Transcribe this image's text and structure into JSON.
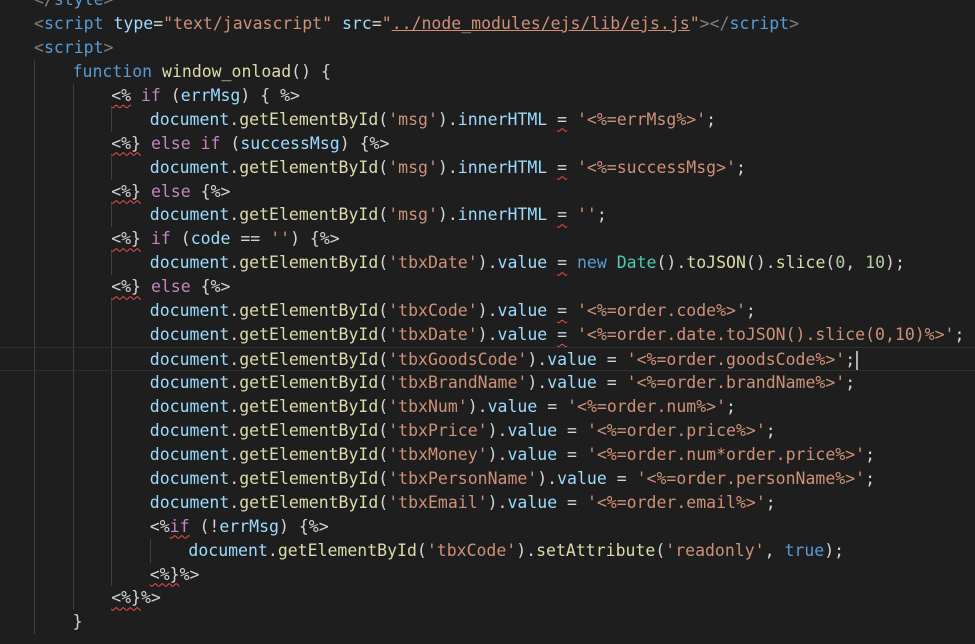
{
  "editor": {
    "language": "html",
    "theme_colors": {
      "background": "#1e1e1e",
      "tag": "#569cd6",
      "attribute": "#9cdcfe",
      "string": "#ce9178",
      "keyword": "#569cd6",
      "control": "#c586c0",
      "function": "#dcdcaa",
      "variable": "#9cdcfe",
      "class": "#4ec9b0",
      "number": "#b5cea8",
      "error_squiggle": "#f14c4c"
    },
    "lines": [
      {
        "indent": 0,
        "tokens": [
          [
            "</",
            "punct"
          ],
          [
            "style",
            "tag"
          ],
          [
            ">",
            "punct"
          ]
        ]
      },
      {
        "indent": 0,
        "tokens": [
          [
            "<",
            "punct"
          ],
          [
            "script",
            "tag"
          ],
          [
            " ",
            "plain"
          ],
          [
            "type",
            "attr"
          ],
          [
            "=",
            "plain"
          ],
          [
            "\"text/javascript\"",
            "str"
          ],
          [
            " ",
            "plain"
          ],
          [
            "src",
            "attr"
          ],
          [
            "=",
            "plain"
          ],
          [
            "\"",
            "str"
          ],
          [
            "../node_modules/ejs/lib/ejs.js",
            "str link"
          ],
          [
            "\"",
            "str"
          ],
          [
            "></",
            "punct"
          ],
          [
            "script",
            "tag"
          ],
          [
            ">",
            "punct"
          ]
        ]
      },
      {
        "indent": 0,
        "tokens": [
          [
            "<",
            "punct"
          ],
          [
            "script",
            "tag"
          ],
          [
            ">",
            "punct"
          ]
        ]
      },
      {
        "indent": 1,
        "tokens": [
          [
            "function",
            "kw"
          ],
          [
            " ",
            "plain"
          ],
          [
            "window_onload",
            "fn"
          ],
          [
            "() {",
            "plain"
          ]
        ]
      },
      {
        "indent": 2,
        "tokens": [
          [
            "<%",
            "plain squig"
          ],
          [
            " ",
            "plain"
          ],
          [
            "if",
            "ctrl"
          ],
          [
            " (",
            "plain"
          ],
          [
            "errMsg",
            "var"
          ],
          [
            ") { ",
            "plain"
          ],
          [
            "%>",
            "plain"
          ]
        ]
      },
      {
        "indent": 3,
        "tokens": [
          [
            "document",
            "var"
          ],
          [
            ".",
            "plain"
          ],
          [
            "getElementById",
            "fn"
          ],
          [
            "(",
            "plain"
          ],
          [
            "'msg'",
            "str"
          ],
          [
            ").",
            "plain"
          ],
          [
            "innerHTML",
            "var"
          ],
          [
            " ",
            "plain"
          ],
          [
            "=",
            "plain squig"
          ],
          [
            " ",
            "plain"
          ],
          [
            "'<%=errMsg%>'",
            "str"
          ],
          [
            ";",
            "plain"
          ]
        ]
      },
      {
        "indent": 2,
        "tokens": [
          [
            "<%}",
            "plain squig"
          ],
          [
            " ",
            "plain"
          ],
          [
            "else",
            "ctrl"
          ],
          [
            " ",
            "plain"
          ],
          [
            "if",
            "ctrl"
          ],
          [
            " (",
            "plain"
          ],
          [
            "successMsg",
            "var"
          ],
          [
            ") {",
            "plain"
          ],
          [
            "%>",
            "plain"
          ]
        ]
      },
      {
        "indent": 3,
        "tokens": [
          [
            "document",
            "var"
          ],
          [
            ".",
            "plain"
          ],
          [
            "getElementById",
            "fn"
          ],
          [
            "(",
            "plain"
          ],
          [
            "'msg'",
            "str"
          ],
          [
            ").",
            "plain"
          ],
          [
            "innerHTML",
            "var"
          ],
          [
            " ",
            "plain"
          ],
          [
            "=",
            "plain squig"
          ],
          [
            " ",
            "plain"
          ],
          [
            "'<%=successMsg>'",
            "str"
          ],
          [
            ";",
            "plain"
          ]
        ]
      },
      {
        "indent": 2,
        "tokens": [
          [
            "<%}",
            "plain squig"
          ],
          [
            " ",
            "plain"
          ],
          [
            "else",
            "ctrl"
          ],
          [
            " {",
            "plain"
          ],
          [
            "%>",
            "plain"
          ]
        ]
      },
      {
        "indent": 3,
        "tokens": [
          [
            "document",
            "var"
          ],
          [
            ".",
            "plain"
          ],
          [
            "getElementById",
            "fn"
          ],
          [
            "(",
            "plain"
          ],
          [
            "'msg'",
            "str"
          ],
          [
            ").",
            "plain"
          ],
          [
            "innerHTML",
            "var"
          ],
          [
            " ",
            "plain"
          ],
          [
            "=",
            "plain squig"
          ],
          [
            " ",
            "plain"
          ],
          [
            "''",
            "str"
          ],
          [
            ";",
            "plain"
          ]
        ]
      },
      {
        "indent": 2,
        "tokens": [
          [
            "<%}",
            "plain squig"
          ],
          [
            " ",
            "plain"
          ],
          [
            "if",
            "ctrl"
          ],
          [
            " (",
            "plain"
          ],
          [
            "code",
            "var"
          ],
          [
            " == ",
            "plain"
          ],
          [
            "''",
            "str"
          ],
          [
            ") {",
            "plain"
          ],
          [
            "%>",
            "plain"
          ]
        ]
      },
      {
        "indent": 3,
        "tokens": [
          [
            "document",
            "var"
          ],
          [
            ".",
            "plain"
          ],
          [
            "getElementById",
            "fn"
          ],
          [
            "(",
            "plain"
          ],
          [
            "'tbxDate'",
            "str"
          ],
          [
            ").",
            "plain"
          ],
          [
            "value",
            "var"
          ],
          [
            " ",
            "plain"
          ],
          [
            "=",
            "plain squig"
          ],
          [
            " ",
            "plain"
          ],
          [
            "new",
            "kw"
          ],
          [
            " ",
            "plain"
          ],
          [
            "Date",
            "cls"
          ],
          [
            "().",
            "plain"
          ],
          [
            "toJSON",
            "fn"
          ],
          [
            "().",
            "plain"
          ],
          [
            "slice",
            "fn"
          ],
          [
            "(",
            "plain"
          ],
          [
            "0",
            "num"
          ],
          [
            ", ",
            "plain"
          ],
          [
            "10",
            "num"
          ],
          [
            ");",
            "plain"
          ]
        ]
      },
      {
        "indent": 2,
        "tokens": [
          [
            "<%}",
            "plain squig"
          ],
          [
            " ",
            "plain"
          ],
          [
            "else",
            "ctrl"
          ],
          [
            " {",
            "plain"
          ],
          [
            "%>",
            "plain"
          ]
        ]
      },
      {
        "indent": 3,
        "tokens": [
          [
            "document",
            "var"
          ],
          [
            ".",
            "plain"
          ],
          [
            "getElementById",
            "fn"
          ],
          [
            "(",
            "plain"
          ],
          [
            "'tbxCode'",
            "str"
          ],
          [
            ").",
            "plain"
          ],
          [
            "value",
            "var"
          ],
          [
            " ",
            "plain"
          ],
          [
            "=",
            "plain squig"
          ],
          [
            " ",
            "plain"
          ],
          [
            "'<%=order.code%>'",
            "str"
          ],
          [
            ";",
            "plain"
          ]
        ]
      },
      {
        "indent": 3,
        "tokens": [
          [
            "document",
            "var"
          ],
          [
            ".",
            "plain"
          ],
          [
            "getElementById",
            "fn"
          ],
          [
            "(",
            "plain"
          ],
          [
            "'tbxDate'",
            "str"
          ],
          [
            ").",
            "plain"
          ],
          [
            "value",
            "var"
          ],
          [
            " ",
            "plain"
          ],
          [
            "=",
            "plain squig"
          ],
          [
            " ",
            "plain"
          ],
          [
            "'<%=order.date.toJSON().slice(0,10)%>'",
            "str"
          ],
          [
            ";",
            "plain"
          ]
        ]
      },
      {
        "indent": 3,
        "current": true,
        "cursor": true,
        "tokens": [
          [
            "document",
            "var"
          ],
          [
            ".",
            "plain"
          ],
          [
            "getElementById",
            "fn"
          ],
          [
            "(",
            "plain"
          ],
          [
            "'tbxGoodsCode'",
            "str"
          ],
          [
            ").",
            "plain"
          ],
          [
            "value",
            "var"
          ],
          [
            " = ",
            "plain"
          ],
          [
            "'<%=order.goodsCode%>'",
            "str"
          ],
          [
            ";",
            "plain"
          ]
        ]
      },
      {
        "indent": 3,
        "tokens": [
          [
            "document",
            "var"
          ],
          [
            ".",
            "plain"
          ],
          [
            "getElementById",
            "fn"
          ],
          [
            "(",
            "plain"
          ],
          [
            "'tbxBrandName'",
            "str"
          ],
          [
            ").",
            "plain"
          ],
          [
            "value",
            "var"
          ],
          [
            " = ",
            "plain"
          ],
          [
            "'<%=order.brandName%>'",
            "str"
          ],
          [
            ";",
            "plain"
          ]
        ]
      },
      {
        "indent": 3,
        "tokens": [
          [
            "document",
            "var"
          ],
          [
            ".",
            "plain"
          ],
          [
            "getElementById",
            "fn"
          ],
          [
            "(",
            "plain"
          ],
          [
            "'tbxNum'",
            "str"
          ],
          [
            ").",
            "plain"
          ],
          [
            "value",
            "var"
          ],
          [
            " = ",
            "plain"
          ],
          [
            "'<%=order.num%>'",
            "str"
          ],
          [
            ";",
            "plain"
          ]
        ]
      },
      {
        "indent": 3,
        "tokens": [
          [
            "document",
            "var"
          ],
          [
            ".",
            "plain"
          ],
          [
            "getElementById",
            "fn"
          ],
          [
            "(",
            "plain"
          ],
          [
            "'tbxPrice'",
            "str"
          ],
          [
            ").",
            "plain"
          ],
          [
            "value",
            "var"
          ],
          [
            " = ",
            "plain"
          ],
          [
            "'<%=order.price%>'",
            "str"
          ],
          [
            ";",
            "plain"
          ]
        ]
      },
      {
        "indent": 3,
        "tokens": [
          [
            "document",
            "var"
          ],
          [
            ".",
            "plain"
          ],
          [
            "getElementById",
            "fn"
          ],
          [
            "(",
            "plain"
          ],
          [
            "'tbxMoney'",
            "str"
          ],
          [
            ").",
            "plain"
          ],
          [
            "value",
            "var"
          ],
          [
            " = ",
            "plain"
          ],
          [
            "'<%=order.num*order.price%>'",
            "str"
          ],
          [
            ";",
            "plain"
          ]
        ]
      },
      {
        "indent": 3,
        "tokens": [
          [
            "document",
            "var"
          ],
          [
            ".",
            "plain"
          ],
          [
            "getElementById",
            "fn"
          ],
          [
            "(",
            "plain"
          ],
          [
            "'tbxPersonName'",
            "str"
          ],
          [
            ").",
            "plain"
          ],
          [
            "value",
            "var"
          ],
          [
            " = ",
            "plain"
          ],
          [
            "'<%=order.personName%>'",
            "str"
          ],
          [
            ";",
            "plain"
          ]
        ]
      },
      {
        "indent": 3,
        "tokens": [
          [
            "document",
            "var"
          ],
          [
            ".",
            "plain"
          ],
          [
            "getElementById",
            "fn"
          ],
          [
            "(",
            "plain"
          ],
          [
            "'tbxEmail'",
            "str"
          ],
          [
            ").",
            "plain"
          ],
          [
            "value",
            "var"
          ],
          [
            " = ",
            "plain"
          ],
          [
            "'<%=order.email%>'",
            "str"
          ],
          [
            ";",
            "plain"
          ]
        ]
      },
      {
        "indent": 3,
        "tokens": [
          [
            "<%",
            "plain"
          ],
          [
            "if",
            "ctrl squig"
          ],
          [
            " (!",
            "plain"
          ],
          [
            "errMsg",
            "var"
          ],
          [
            ") {",
            "plain"
          ],
          [
            "%>",
            "plain"
          ]
        ]
      },
      {
        "indent": 4,
        "tokens": [
          [
            "document",
            "var"
          ],
          [
            ".",
            "plain"
          ],
          [
            "getElementById",
            "fn"
          ],
          [
            "(",
            "plain"
          ],
          [
            "'tbxCode'",
            "str"
          ],
          [
            ").",
            "plain"
          ],
          [
            "setAttribute",
            "fn"
          ],
          [
            "(",
            "plain"
          ],
          [
            "'readonly'",
            "str"
          ],
          [
            ", ",
            "plain"
          ],
          [
            "true",
            "kw"
          ],
          [
            ");",
            "plain"
          ]
        ]
      },
      {
        "indent": 3,
        "tokens": [
          [
            "<%}",
            "plain squig"
          ],
          [
            "%>",
            "plain"
          ]
        ]
      },
      {
        "indent": 2,
        "tokens": [
          [
            "<%}",
            "plain squig"
          ],
          [
            "%>",
            "plain"
          ]
        ]
      },
      {
        "indent": 1,
        "tokens": [
          [
            "}",
            "plain"
          ]
        ]
      }
    ]
  }
}
